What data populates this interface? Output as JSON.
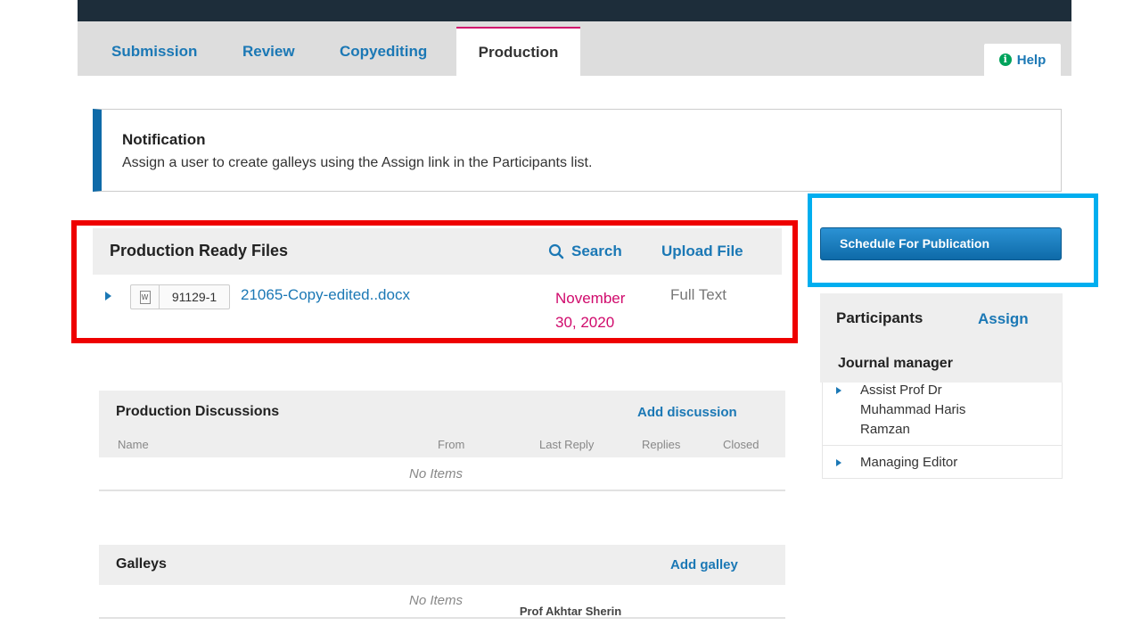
{
  "tabs": [
    {
      "label": "Submission"
    },
    {
      "label": "Review"
    },
    {
      "label": "Copyediting"
    },
    {
      "label": "Production"
    }
  ],
  "help": {
    "label": "Help",
    "icon": "info-icon",
    "icon_glyph": "i"
  },
  "notification": {
    "title": "Notification",
    "text": "Assign a user to create galleys using the Assign link in the Participants list."
  },
  "production_ready_files": {
    "title": "Production Ready Files",
    "search_label": "Search",
    "upload_label": "Upload File",
    "files": [
      {
        "id": "91129-1",
        "name": "21065-Copy-edited..docx",
        "date_line1": "November",
        "date_line2": "30, 2020",
        "type": "Full Text",
        "icon": "word-doc-icon",
        "icon_glyph": "W"
      }
    ]
  },
  "production_discussions": {
    "title": "Production Discussions",
    "add_label": "Add discussion",
    "columns": [
      "Name",
      "From",
      "Last Reply",
      "Replies",
      "Closed"
    ],
    "empty_text": "No Items"
  },
  "galleys": {
    "title": "Galleys",
    "add_label": "Add galley",
    "empty_text": "No Items"
  },
  "schedule_button": {
    "label": "Schedule For Publication"
  },
  "participants": {
    "title": "Participants",
    "assign_label": "Assign",
    "group_label": "Journal manager",
    "people": [
      {
        "line1": "Assist Prof Dr",
        "line2": "Muhammad Haris",
        "line3": "Ramzan"
      },
      {
        "line1": "Managing Editor"
      }
    ]
  },
  "footer": {
    "text": "Prof Akhtar Sherin"
  },
  "colors": {
    "accent_blue": "#1b78b5",
    "active_tab_border": "#d00a6c",
    "highlight_red": "#ee0000",
    "highlight_cyan": "#00aeef"
  }
}
